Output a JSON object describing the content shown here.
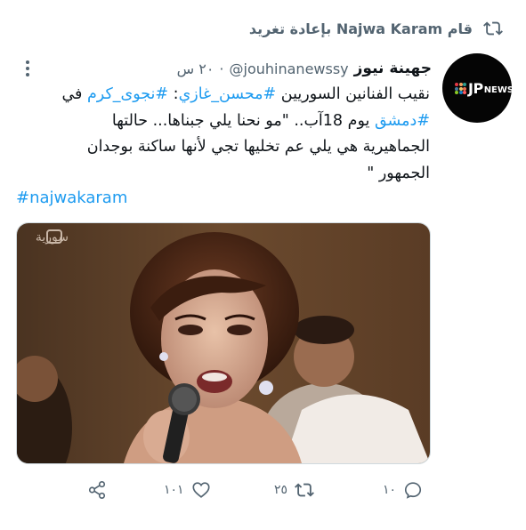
{
  "retweet": {
    "prefix": "قام",
    "user": "Najwa Karam",
    "suffix": "بإعادة تغريد",
    "icon": "retweet-icon"
  },
  "tweet": {
    "display_name": "جهينة نيوز",
    "handle": "@jouhinanewssy",
    "dot": "·",
    "time": "٢٠ س",
    "avatar_logo": {
      "jp": "JP",
      "news": "NEWS"
    },
    "text": {
      "line1_a": "نقيب الفنانين السوريين ",
      "line1_tag1": "#محسن_غازي",
      "line1_b": ": ",
      "line1_tag2": "#نجوى_كرم",
      "line1_c": " في",
      "line2_tag": "#دمشق",
      "line2_b": " يوم 18آب.. \"مو نحنا يلي جبناها... حالتها",
      "line3": "الجماهيرية هي يلي عم تخليها تجي لأنها ساكنة  بوجدان",
      "line4": "الجمهور \""
    },
    "hashtag": "#najwakaram",
    "media": {
      "channel_logo": "سورية"
    }
  },
  "actions": {
    "share_icon": "share-icon",
    "like_count": "١٠١",
    "retweet_count": "٢٥",
    "reply_count": "١٠"
  },
  "colors": {
    "link": "#1d9bf0",
    "secondary": "#536471",
    "text": "#0f1419"
  }
}
